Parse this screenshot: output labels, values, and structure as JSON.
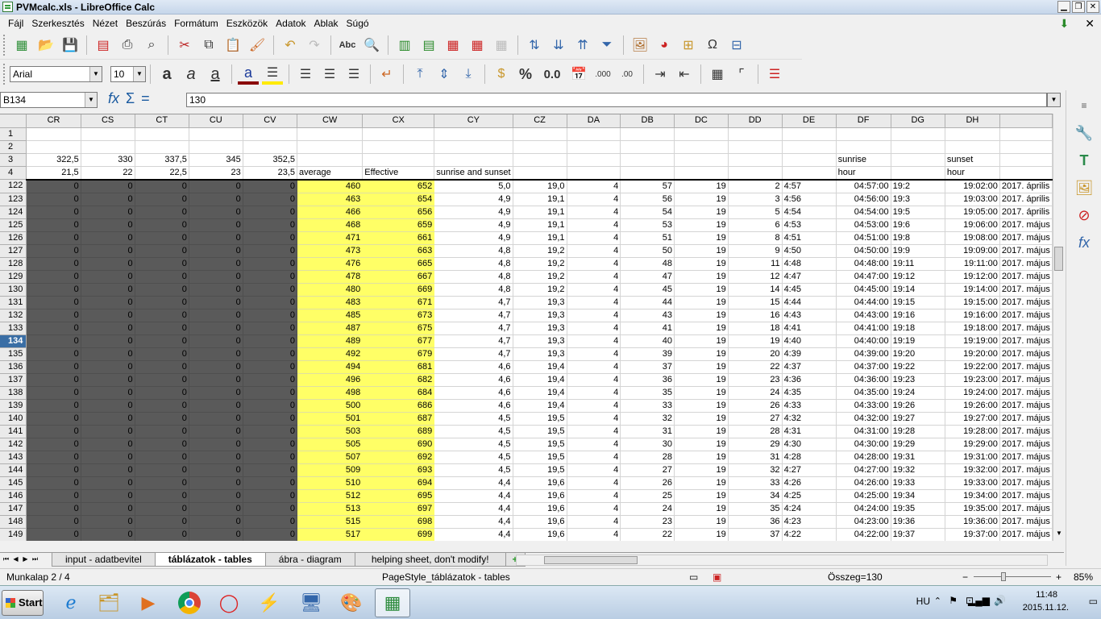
{
  "window": {
    "title": "PVMcalc.xls - LibreOffice Calc"
  },
  "menu": [
    "Fájl",
    "Szerkesztés",
    "Nézet",
    "Beszúrás",
    "Formátum",
    "Eszközök",
    "Adatok",
    "Ablak",
    "Súgó"
  ],
  "toolbar": {
    "font_name": "Arial",
    "font_size": "10",
    "percent": "%",
    "number": "0.0"
  },
  "formula": {
    "cell_ref": "B134",
    "content": "130"
  },
  "columns": [
    "CR",
    "CS",
    "CT",
    "CU",
    "CV",
    "CW",
    "CX",
    "CY",
    "CZ",
    "DA",
    "DB",
    "DC",
    "DD",
    "DE",
    "DF",
    "DG",
    "DH",
    ""
  ],
  "header_rows": [
    {
      "n": "1",
      "cells": [
        "",
        "",
        "",
        "",
        "",
        "",
        "",
        "",
        "",
        "",
        "",
        "",
        "",
        "",
        "",
        "",
        "",
        ""
      ]
    },
    {
      "n": "2",
      "cells": [
        "",
        "",
        "",
        "",
        "",
        "",
        "",
        "",
        "",
        "",
        "",
        "",
        "",
        "",
        "",
        "",
        "",
        ""
      ]
    },
    {
      "n": "3",
      "cells": [
        "322,5",
        "330",
        "337,5",
        "345",
        "352,5",
        "",
        "",
        "",
        "",
        "",
        "",
        "",
        "",
        "",
        "sunrise",
        "",
        "sunset",
        ""
      ]
    },
    {
      "n": "4",
      "cells": [
        "21,5",
        "22",
        "22,5",
        "23",
        "23,5",
        "average",
        "Effective",
        "sunrise and sunset",
        "",
        "",
        "",
        "",
        "",
        "",
        "hour",
        "",
        "hour",
        ""
      ]
    }
  ],
  "rows": [
    {
      "n": "122",
      "cells": [
        "0",
        "0",
        "0",
        "0",
        "0",
        "460",
        "652",
        "5,0",
        "19,0",
        "4",
        "57",
        "19",
        "2",
        "4:57",
        "04:57:00",
        "19:2",
        "19:02:00",
        "2017. április"
      ]
    },
    {
      "n": "123",
      "cells": [
        "0",
        "0",
        "0",
        "0",
        "0",
        "463",
        "654",
        "4,9",
        "19,1",
        "4",
        "56",
        "19",
        "3",
        "4:56",
        "04:56:00",
        "19:3",
        "19:03:00",
        "2017. április"
      ]
    },
    {
      "n": "124",
      "cells": [
        "0",
        "0",
        "0",
        "0",
        "0",
        "466",
        "656",
        "4,9",
        "19,1",
        "4",
        "54",
        "19",
        "5",
        "4:54",
        "04:54:00",
        "19:5",
        "19:05:00",
        "2017. április"
      ]
    },
    {
      "n": "125",
      "cells": [
        "0",
        "0",
        "0",
        "0",
        "0",
        "468",
        "659",
        "4,9",
        "19,1",
        "4",
        "53",
        "19",
        "6",
        "4:53",
        "04:53:00",
        "19:6",
        "19:06:00",
        "2017. május"
      ]
    },
    {
      "n": "126",
      "cells": [
        "0",
        "0",
        "0",
        "0",
        "0",
        "471",
        "661",
        "4,9",
        "19,1",
        "4",
        "51",
        "19",
        "8",
        "4:51",
        "04:51:00",
        "19:8",
        "19:08:00",
        "2017. május"
      ]
    },
    {
      "n": "127",
      "cells": [
        "0",
        "0",
        "0",
        "0",
        "0",
        "473",
        "663",
        "4,8",
        "19,2",
        "4",
        "50",
        "19",
        "9",
        "4:50",
        "04:50:00",
        "19:9",
        "19:09:00",
        "2017. május"
      ]
    },
    {
      "n": "128",
      "cells": [
        "0",
        "0",
        "0",
        "0",
        "0",
        "476",
        "665",
        "4,8",
        "19,2",
        "4",
        "48",
        "19",
        "11",
        "4:48",
        "04:48:00",
        "19:11",
        "19:11:00",
        "2017. május"
      ]
    },
    {
      "n": "129",
      "cells": [
        "0",
        "0",
        "0",
        "0",
        "0",
        "478",
        "667",
        "4,8",
        "19,2",
        "4",
        "47",
        "19",
        "12",
        "4:47",
        "04:47:00",
        "19:12",
        "19:12:00",
        "2017. május"
      ]
    },
    {
      "n": "130",
      "cells": [
        "0",
        "0",
        "0",
        "0",
        "0",
        "480",
        "669",
        "4,8",
        "19,2",
        "4",
        "45",
        "19",
        "14",
        "4:45",
        "04:45:00",
        "19:14",
        "19:14:00",
        "2017. május"
      ]
    },
    {
      "n": "131",
      "cells": [
        "0",
        "0",
        "0",
        "0",
        "0",
        "483",
        "671",
        "4,7",
        "19,3",
        "4",
        "44",
        "19",
        "15",
        "4:44",
        "04:44:00",
        "19:15",
        "19:15:00",
        "2017. május"
      ]
    },
    {
      "n": "132",
      "cells": [
        "0",
        "0",
        "0",
        "0",
        "0",
        "485",
        "673",
        "4,7",
        "19,3",
        "4",
        "43",
        "19",
        "16",
        "4:43",
        "04:43:00",
        "19:16",
        "19:16:00",
        "2017. május"
      ]
    },
    {
      "n": "133",
      "cells": [
        "0",
        "0",
        "0",
        "0",
        "0",
        "487",
        "675",
        "4,7",
        "19,3",
        "4",
        "41",
        "19",
        "18",
        "4:41",
        "04:41:00",
        "19:18",
        "19:18:00",
        "2017. május"
      ]
    },
    {
      "n": "134",
      "cells": [
        "0",
        "0",
        "0",
        "0",
        "0",
        "489",
        "677",
        "4,7",
        "19,3",
        "4",
        "40",
        "19",
        "19",
        "4:40",
        "04:40:00",
        "19:19",
        "19:19:00",
        "2017. május"
      ]
    },
    {
      "n": "135",
      "cells": [
        "0",
        "0",
        "0",
        "0",
        "0",
        "492",
        "679",
        "4,7",
        "19,3",
        "4",
        "39",
        "19",
        "20",
        "4:39",
        "04:39:00",
        "19:20",
        "19:20:00",
        "2017. május"
      ]
    },
    {
      "n": "136",
      "cells": [
        "0",
        "0",
        "0",
        "0",
        "0",
        "494",
        "681",
        "4,6",
        "19,4",
        "4",
        "37",
        "19",
        "22",
        "4:37",
        "04:37:00",
        "19:22",
        "19:22:00",
        "2017. május"
      ]
    },
    {
      "n": "137",
      "cells": [
        "0",
        "0",
        "0",
        "0",
        "0",
        "496",
        "682",
        "4,6",
        "19,4",
        "4",
        "36",
        "19",
        "23",
        "4:36",
        "04:36:00",
        "19:23",
        "19:23:00",
        "2017. május"
      ]
    },
    {
      "n": "138",
      "cells": [
        "0",
        "0",
        "0",
        "0",
        "0",
        "498",
        "684",
        "4,6",
        "19,4",
        "4",
        "35",
        "19",
        "24",
        "4:35",
        "04:35:00",
        "19:24",
        "19:24:00",
        "2017. május"
      ]
    },
    {
      "n": "139",
      "cells": [
        "0",
        "0",
        "0",
        "0",
        "0",
        "500",
        "686",
        "4,6",
        "19,4",
        "4",
        "33",
        "19",
        "26",
        "4:33",
        "04:33:00",
        "19:26",
        "19:26:00",
        "2017. május"
      ]
    },
    {
      "n": "140",
      "cells": [
        "0",
        "0",
        "0",
        "0",
        "0",
        "501",
        "687",
        "4,5",
        "19,5",
        "4",
        "32",
        "19",
        "27",
        "4:32",
        "04:32:00",
        "19:27",
        "19:27:00",
        "2017. május"
      ]
    },
    {
      "n": "141",
      "cells": [
        "0",
        "0",
        "0",
        "0",
        "0",
        "503",
        "689",
        "4,5",
        "19,5",
        "4",
        "31",
        "19",
        "28",
        "4:31",
        "04:31:00",
        "19:28",
        "19:28:00",
        "2017. május"
      ]
    },
    {
      "n": "142",
      "cells": [
        "0",
        "0",
        "0",
        "0",
        "0",
        "505",
        "690",
        "4,5",
        "19,5",
        "4",
        "30",
        "19",
        "29",
        "4:30",
        "04:30:00",
        "19:29",
        "19:29:00",
        "2017. május"
      ]
    },
    {
      "n": "143",
      "cells": [
        "0",
        "0",
        "0",
        "0",
        "0",
        "507",
        "692",
        "4,5",
        "19,5",
        "4",
        "28",
        "19",
        "31",
        "4:28",
        "04:28:00",
        "19:31",
        "19:31:00",
        "2017. május"
      ]
    },
    {
      "n": "144",
      "cells": [
        "0",
        "0",
        "0",
        "0",
        "0",
        "509",
        "693",
        "4,5",
        "19,5",
        "4",
        "27",
        "19",
        "32",
        "4:27",
        "04:27:00",
        "19:32",
        "19:32:00",
        "2017. május"
      ]
    },
    {
      "n": "145",
      "cells": [
        "0",
        "0",
        "0",
        "0",
        "0",
        "510",
        "694",
        "4,4",
        "19,6",
        "4",
        "26",
        "19",
        "33",
        "4:26",
        "04:26:00",
        "19:33",
        "19:33:00",
        "2017. május"
      ]
    },
    {
      "n": "146",
      "cells": [
        "0",
        "0",
        "0",
        "0",
        "0",
        "512",
        "695",
        "4,4",
        "19,6",
        "4",
        "25",
        "19",
        "34",
        "4:25",
        "04:25:00",
        "19:34",
        "19:34:00",
        "2017. május"
      ]
    },
    {
      "n": "147",
      "cells": [
        "0",
        "0",
        "0",
        "0",
        "0",
        "513",
        "697",
        "4,4",
        "19,6",
        "4",
        "24",
        "19",
        "35",
        "4:24",
        "04:24:00",
        "19:35",
        "19:35:00",
        "2017. május"
      ]
    },
    {
      "n": "148",
      "cells": [
        "0",
        "0",
        "0",
        "0",
        "0",
        "515",
        "698",
        "4,4",
        "19,6",
        "4",
        "23",
        "19",
        "36",
        "4:23",
        "04:23:00",
        "19:36",
        "19:36:00",
        "2017. május"
      ]
    },
    {
      "n": "149",
      "cells": [
        "0",
        "0",
        "0",
        "0",
        "0",
        "517",
        "699",
        "4,4",
        "19,6",
        "4",
        "22",
        "19",
        "37",
        "4:22",
        "04:22:00",
        "19:37",
        "19:37:00",
        "2017. május"
      ]
    }
  ],
  "active_row": "134",
  "tabs": [
    {
      "label": "input - adatbevitel",
      "active": false
    },
    {
      "label": "táblázatok - tables",
      "active": true
    },
    {
      "label": "ábra - diagram",
      "active": false
    },
    {
      "label": "helping sheet, don't modify!",
      "active": false
    }
  ],
  "status": {
    "sheet": "Munkalap 2 / 4",
    "page_style": "PageStyle_táblázatok - tables",
    "sum": "Összeg=130",
    "zoom": "85%"
  },
  "taskbar": {
    "start": "Start",
    "lang": "HU",
    "time": "11:48",
    "date": "2015.11.12."
  },
  "colors": {
    "dark_cell": "#5a5a5a",
    "highlight": "#ffff66",
    "active_row_header": "#3a6ea5"
  }
}
